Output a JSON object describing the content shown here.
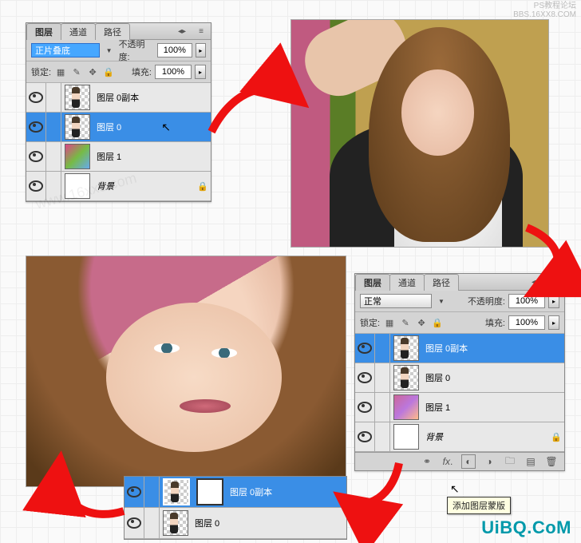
{
  "watermark_top_line1": "PS教程论坛",
  "watermark_top_line2": "BBS.16XX8.COM",
  "watermark_bottom": "UiBQ.CoM",
  "panel1": {
    "tabs": [
      "图层",
      "通道",
      "路径"
    ],
    "blend_mode": "正片叠底",
    "opacity_label": "不透明度:",
    "opacity_value": "100%",
    "lock_label": "锁定:",
    "fill_label": "填充:",
    "fill_value": "100%",
    "layers": [
      {
        "name": "图层 0副本",
        "locked": false
      },
      {
        "name": "图层 0",
        "locked": false
      },
      {
        "name": "图层 1",
        "locked": false
      },
      {
        "name": "背景",
        "locked": true
      }
    ],
    "selected_index": 1
  },
  "panel2": {
    "tabs": [
      "图层",
      "通道",
      "路径"
    ],
    "blend_mode": "正常",
    "opacity_label": "不透明度:",
    "opacity_value": "100%",
    "lock_label": "锁定:",
    "fill_label": "填充:",
    "fill_value": "100%",
    "layers": [
      {
        "name": "图层 0副本",
        "locked": false
      },
      {
        "name": "图层 0",
        "locked": false
      },
      {
        "name": "图层 1",
        "locked": false
      },
      {
        "name": "背景",
        "locked": true
      }
    ],
    "selected_index": 0,
    "tooltip": "添加图层蒙版"
  },
  "mini": {
    "lines": [
      {
        "name": "图层 0副本"
      },
      {
        "name": "图层 0"
      }
    ],
    "selected_index": 0
  }
}
